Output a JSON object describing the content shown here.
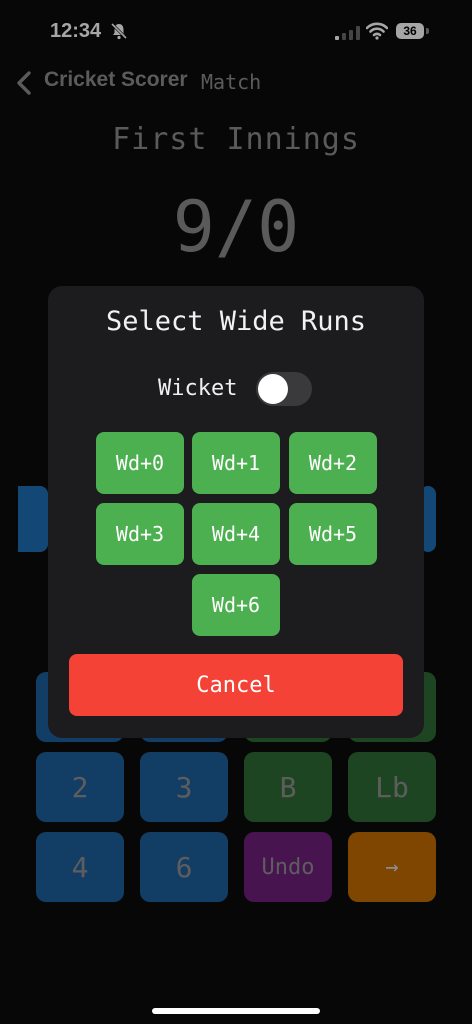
{
  "status_bar": {
    "time": "12:34",
    "battery": "36",
    "icons": [
      "bell-slash-icon",
      "signal-icon",
      "wifi-icon",
      "battery-icon"
    ]
  },
  "header": {
    "back_icon": "chevron-left-icon",
    "title": "Cricket Scorer",
    "subtitle": "Match"
  },
  "innings": {
    "title": "First Innings",
    "score": "9/0"
  },
  "keypad": {
    "keys": [
      "2",
      "3",
      "B",
      "Lb",
      "4",
      "6",
      "Undo",
      "→"
    ]
  },
  "modal": {
    "title": "Select Wide Runs",
    "wicket_label": "Wicket",
    "wicket_on": false,
    "options": [
      "Wd+0",
      "Wd+1",
      "Wd+2",
      "Wd+3",
      "Wd+4",
      "Wd+5",
      "Wd+6"
    ],
    "cancel_label": "Cancel"
  },
  "colors": {
    "wide_button": "#4caf50",
    "cancel_button": "#f44336",
    "run_key": "#1d5f9a",
    "extra_key": "#2f6a34",
    "undo_key": "#6e1f7c",
    "next_key": "#c26c00"
  }
}
